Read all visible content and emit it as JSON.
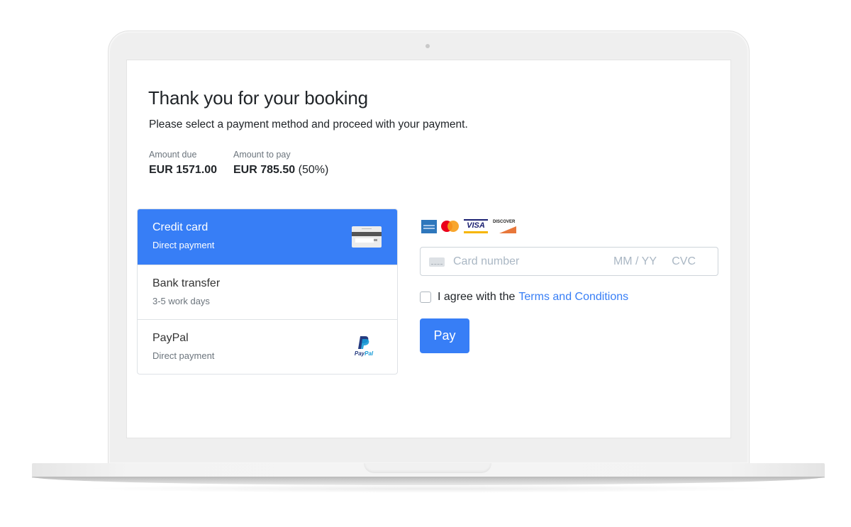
{
  "page": {
    "title": "Thank you for your booking",
    "subtitle": "Please select a payment method and proceed with your payment."
  },
  "amounts": {
    "due": {
      "label": "Amount due",
      "value": "EUR 1571.00"
    },
    "to_pay": {
      "label": "Amount to pay",
      "value": "EUR 785.50",
      "percent": "(50%)"
    }
  },
  "payment_methods": [
    {
      "title": "Credit card",
      "subtitle": "Direct payment",
      "icon": "credit-card-icon",
      "selected": true
    },
    {
      "title": "Bank transfer",
      "subtitle": "3-5 work days",
      "icon": null,
      "selected": false
    },
    {
      "title": "PayPal",
      "subtitle": "Direct payment",
      "icon": "paypal-icon",
      "selected": false
    }
  ],
  "card_brands": {
    "amex": "American Express",
    "mastercard": "Mastercard",
    "visa": "VISA",
    "discover": "DISCOVER"
  },
  "card_form": {
    "number_placeholder": "Card number",
    "expiry_placeholder": "MM / YY",
    "cvc_placeholder": "CVC"
  },
  "agreement": {
    "prefix": "I agree with the",
    "link": "Terms and Conditions",
    "checked": false
  },
  "pay_button": {
    "label": "Pay"
  },
  "paypal_logo_text": {
    "pay": "Pay",
    "pal": "Pal"
  },
  "colors": {
    "accent": "#377ef6",
    "text": "#212529",
    "muted": "#6c757d",
    "placeholder": "#aab7c4"
  }
}
